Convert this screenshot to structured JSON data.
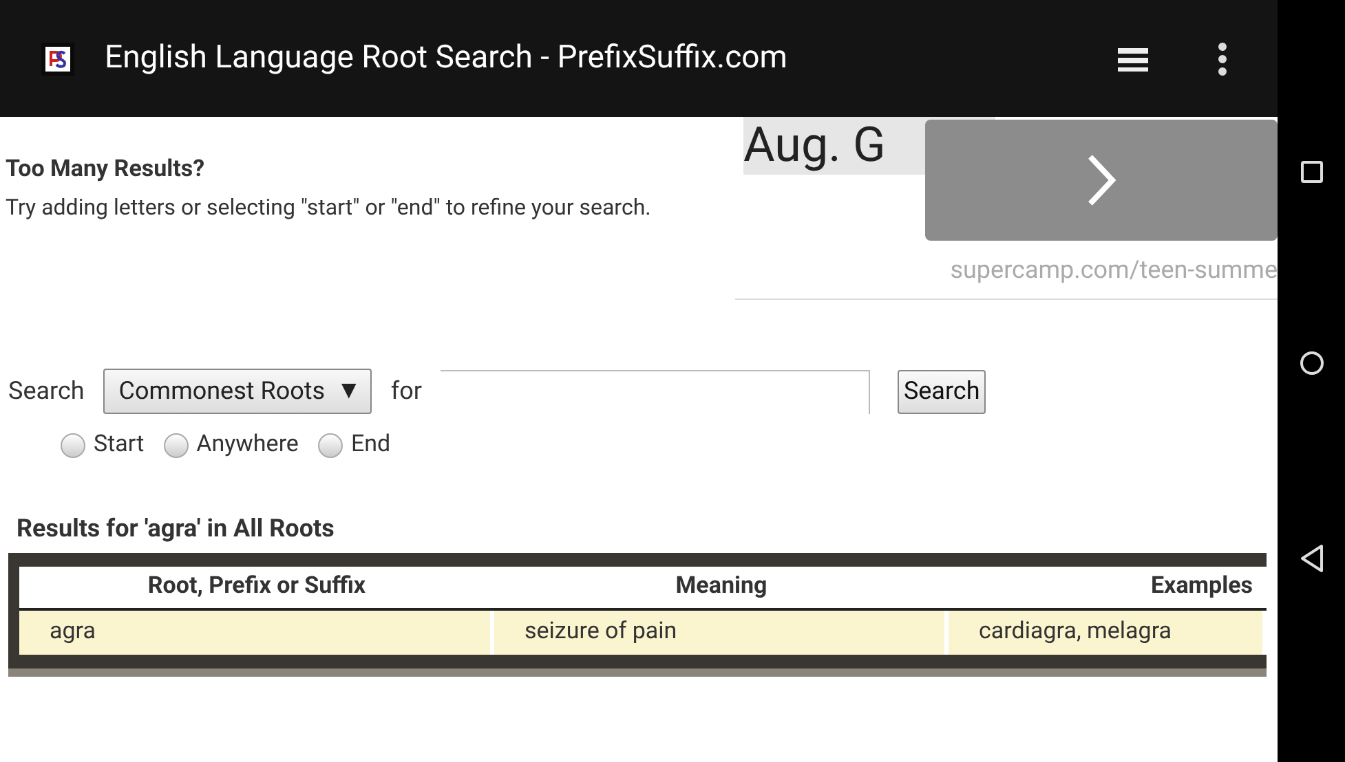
{
  "app_bar": {
    "title": "English Language Root Search - PrefixSuffix.com"
  },
  "notice": {
    "heading": "Too Many Results?",
    "text": "Try adding letters or selecting \"start\" or \"end\" to refine your search."
  },
  "ad": {
    "headline": "Aug. G",
    "url": "supercamp.com/teen-summe"
  },
  "search": {
    "label": "Search",
    "dropdown": "Commonest Roots",
    "caret": "▼",
    "for_label": "for",
    "button": "Search"
  },
  "positions": [
    {
      "label": "Start",
      "selected": false
    },
    {
      "label": "Anywhere",
      "selected": false
    },
    {
      "label": "End",
      "selected": false
    }
  ],
  "results": {
    "title": "Results for 'agra' in All Roots",
    "columns": [
      "Root, Prefix or Suffix",
      "Meaning",
      "Examples"
    ],
    "rows": [
      [
        "agra",
        "seizure of pain",
        "cardiagra, melagra"
      ]
    ]
  }
}
